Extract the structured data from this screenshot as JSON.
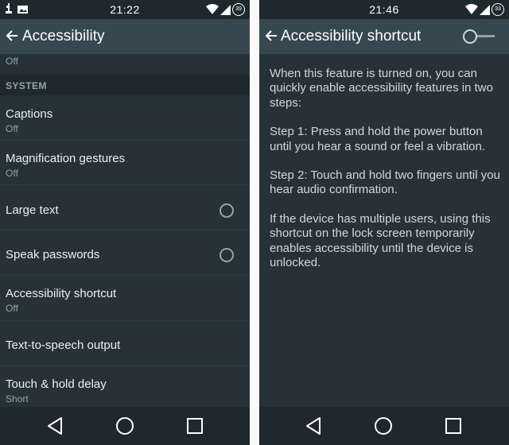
{
  "left": {
    "status": {
      "time": "21:22",
      "battery": "39"
    },
    "header": {
      "title": "Accessibility"
    },
    "top_summary": "Off",
    "section": "SYSTEM",
    "items": [
      {
        "title": "Captions",
        "subtitle": "Off"
      },
      {
        "title": "Magnification gestures",
        "subtitle": "Off"
      },
      {
        "title": "Large text"
      },
      {
        "title": "Speak passwords"
      },
      {
        "title": "Accessibility shortcut",
        "subtitle": "Off"
      },
      {
        "title": "Text-to-speech output"
      },
      {
        "title": "Touch & hold delay",
        "subtitle": "Short"
      }
    ]
  },
  "right": {
    "status": {
      "time": "21:46",
      "battery": "33"
    },
    "header": {
      "title": "Accessibility shortcut"
    },
    "switch_state": "off",
    "paragraphs": [
      "When this feature is turned on, you can quickly enable accessibility features in two steps:",
      "Step 1: Press and hold the power button until you hear a sound or feel a vibration.",
      "Step 2: Touch and hold two fingers until you hear audio confirmation.",
      "If the device has multiple users, using this shortcut on the lock screen temporarily enables accessibility until the device is unlocked."
    ]
  },
  "colors": {
    "background": "#263238",
    "action_bar": "#37474f",
    "status_bar": "#1f282d",
    "secondary_text": "#90a4ae"
  }
}
